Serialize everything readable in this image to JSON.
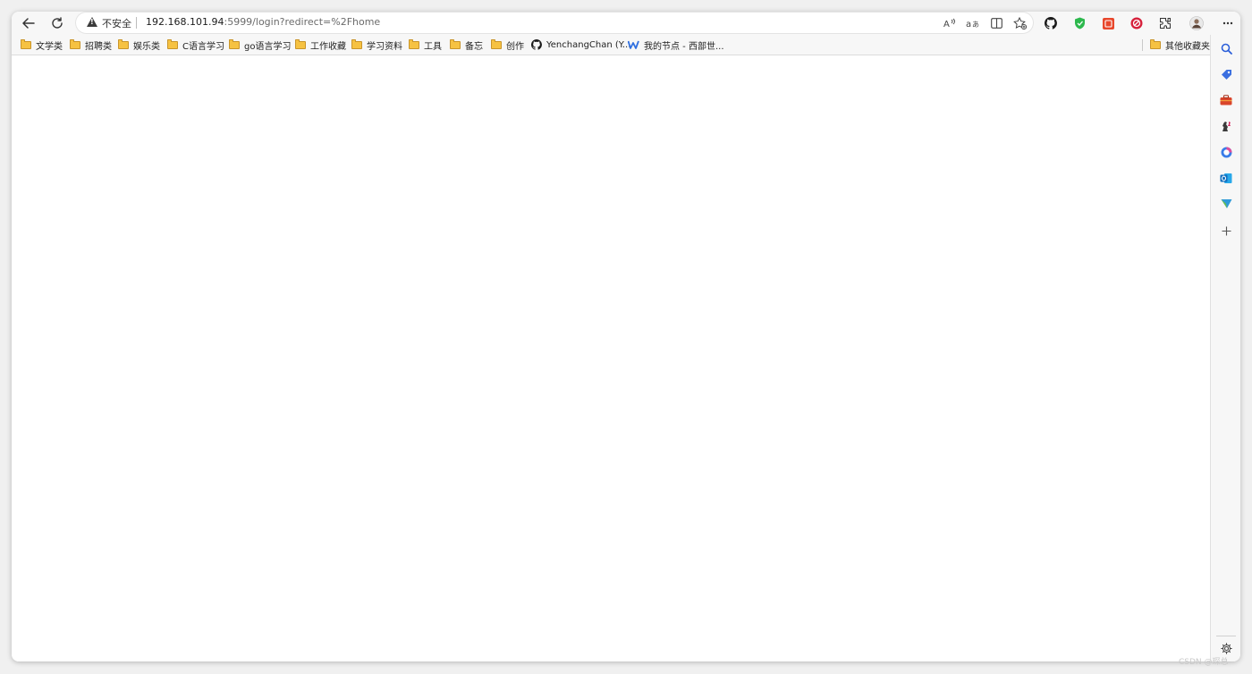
{
  "address": {
    "security_label": "不安全",
    "url_host": "192.168.101.94",
    "url_path": ":5999/login?redirect=%2Fhome"
  },
  "bookmarks": {
    "items": [
      {
        "label": "文学类",
        "icon": "folder-icon"
      },
      {
        "label": "招聘类",
        "icon": "folder-icon"
      },
      {
        "label": "娱乐类",
        "icon": "folder-icon"
      },
      {
        "label": "C语言学习",
        "icon": "folder-icon"
      },
      {
        "label": "go语言学习",
        "icon": "folder-icon"
      },
      {
        "label": "工作收藏",
        "icon": "folder-icon"
      },
      {
        "label": "学习资料",
        "icon": "folder-icon"
      },
      {
        "label": "工具",
        "icon": "folder-icon"
      },
      {
        "label": "备忘",
        "icon": "folder-icon"
      },
      {
        "label": "创作",
        "icon": "folder-icon"
      },
      {
        "label": "YenchangChan (Y...",
        "icon": "github-icon"
      },
      {
        "label": "我的节点 - 西部世...",
        "icon": "w-logo-icon"
      }
    ],
    "other_label": "其他收藏夹"
  },
  "icons": {
    "toolbar": [
      "back-arrow-icon",
      "refresh-icon",
      "read-aloud-icon",
      "translate-icon",
      "split-screen-icon",
      "add-favorite-icon",
      "github-icon",
      "shield-extension-icon",
      "red-extension-icon",
      "red-circle-extension-icon",
      "extensions-puzzle-icon",
      "profile-avatar-icon",
      "more-menu-icon"
    ],
    "sidebar": [
      "search-icon",
      "tag-icon",
      "toolbox-icon",
      "chess-icon",
      "office-icon",
      "outlook-icon",
      "send-icon",
      "add-icon",
      "settings-gear-icon"
    ]
  },
  "colors": {
    "folder": "#f6c242",
    "shield_green": "#2db84d",
    "extension_red": "#e8472c",
    "outlook_blue": "#0f6cbd"
  },
  "watermark": "CSDN @琛总"
}
